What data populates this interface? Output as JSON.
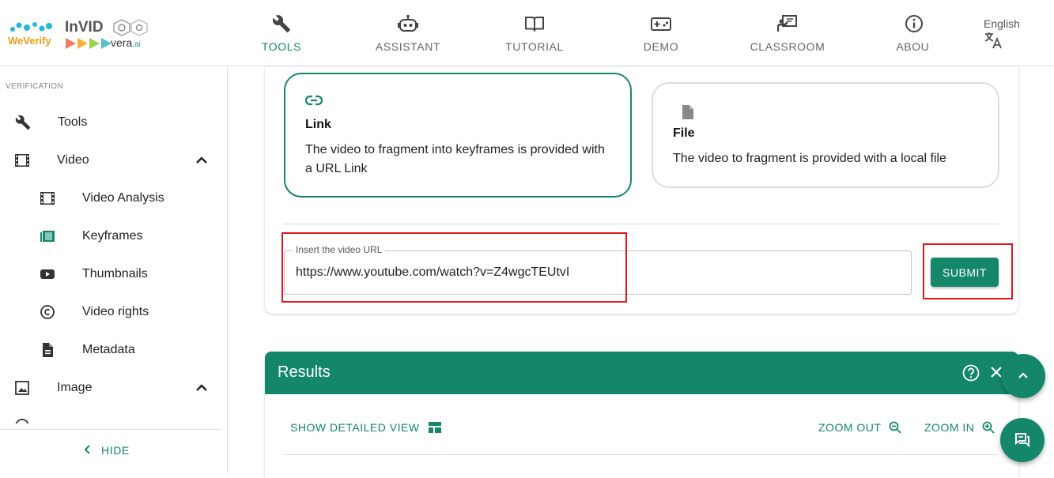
{
  "brand": {
    "weverify": "WeVerify",
    "invid": "InVID",
    "vera": "vera",
    "vera_ai": ".ai"
  },
  "nav": [
    {
      "label": "TOOLS",
      "icon": "wrench-icon",
      "active": true
    },
    {
      "label": "ASSISTANT",
      "icon": "robot-icon",
      "active": false
    },
    {
      "label": "TUTORIAL",
      "icon": "book-icon",
      "active": false
    },
    {
      "label": "DEMO",
      "icon": "gamepad-icon",
      "active": false
    },
    {
      "label": "CLASSROOM",
      "icon": "classroom-icon",
      "active": false
    },
    {
      "label": "ABOU'",
      "icon": "info-icon",
      "active": false
    }
  ],
  "language": {
    "label": "English",
    "icon": "translate-icon"
  },
  "sidebar": {
    "section_title": "VERIFICATION",
    "items": [
      {
        "label": "Tools",
        "icon": "wrench-icon"
      },
      {
        "label": "Video",
        "icon": "film-icon",
        "expanded": true
      },
      {
        "label": "Video Analysis",
        "icon": "film-icon"
      },
      {
        "label": "Keyframes",
        "icon": "keyframes-icon",
        "selected": true
      },
      {
        "label": "Thumbnails",
        "icon": "youtube-icon"
      },
      {
        "label": "Video rights",
        "icon": "copyright-icon"
      },
      {
        "label": "Metadata",
        "icon": "document-icon"
      },
      {
        "label": "Image",
        "icon": "image-icon",
        "expanded": true
      }
    ],
    "hide_label": "HIDE"
  },
  "input_options": {
    "link": {
      "title": "Link",
      "description": "The video to fragment into keyframes is provided with a URL Link",
      "selected": true
    },
    "file": {
      "title": "File",
      "description": "The video to fragment is provided with a local file",
      "selected": false
    }
  },
  "url_input": {
    "label": "Insert the video URL",
    "value": "https://www.youtube.com/watch?v=Z4wgcTEUtvI"
  },
  "submit_label": "SUBMIT",
  "results": {
    "title": "Results",
    "show_detailed_view": "SHOW DETAILED VIEW",
    "zoom_out": "ZOOM OUT",
    "zoom_in": "ZOOM IN"
  },
  "colors": {
    "accent": "#14876a",
    "highlight_box": "#e8141b"
  }
}
